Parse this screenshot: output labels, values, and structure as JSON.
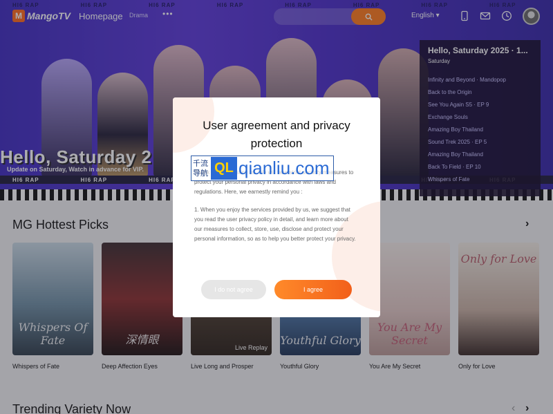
{
  "nav": {
    "logo_mark": "M",
    "logo_text": "MangoTV",
    "homepage": "Homepage",
    "drama": "Drama",
    "more": "•••",
    "language": "English",
    "language_caret": "▾",
    "icons": [
      "search-icon",
      "phone-icon",
      "mail-icon",
      "history-icon",
      "avatar"
    ]
  },
  "hero": {
    "strip_text": "HI6 RAP",
    "title": "Hello, Saturday 2",
    "subtitle": "Update on Saturday, Watch in advance for VIP."
  },
  "schedule": {
    "title": "Hello, Saturday 2025 · 1...",
    "day": "Saturday",
    "items": [
      "Infinity and Beyond · Mandopop",
      "Back to the Origin",
      "See You Again S5 · EP 9",
      "Exchange Souls",
      "Amazing Boy Thailand",
      "Sound Trek 2025 · EP 5",
      "Amazing Boy Thailand",
      "Back To Field · EP 10",
      "Whispers of Fate"
    ]
  },
  "section1": {
    "title": "MG Hottest Picks",
    "arrow": "›",
    "cards": [
      {
        "title": "Whispers of Fate",
        "poster_text": "Whispers Of Fate",
        "tag": ""
      },
      {
        "title": "Deep Affection Eyes",
        "poster_text": "深情眼",
        "tag": ""
      },
      {
        "title": "Live Long and Prosper",
        "poster_text": "",
        "tag": "Live Replay"
      },
      {
        "title": "Youthful Glory",
        "poster_text": "Youthful Glory",
        "tag": ""
      },
      {
        "title": "You Are My Secret",
        "poster_text": "You Are My Secret",
        "tag": ""
      },
      {
        "title": "Only for Love",
        "poster_text": "Only for Love",
        "tag": ""
      }
    ]
  },
  "section2": {
    "title": "Trending Variety Now",
    "arrow_left": "‹",
    "arrow_right": "›"
  },
  "modal": {
    "title": "User agreement and privacy protection",
    "paragraphs": [
      "Thank you for trusting us. We will take strict security measures to protect your personal privacy in accordance with laws and regulations. Here, we earnestly remind you :",
      "1. When you enjoy the services provided by us, we suggest that you read the user privacy policy in detail, and learn more about our measures to collect, store, use, disclose and protect your personal information, so as to help you better protect your privacy."
    ],
    "disagree_label": "I do not agree",
    "agree_label": "I agree"
  },
  "watermark": {
    "cn": "千流导航",
    "badge": "QL",
    "text": "qianliu.com"
  }
}
